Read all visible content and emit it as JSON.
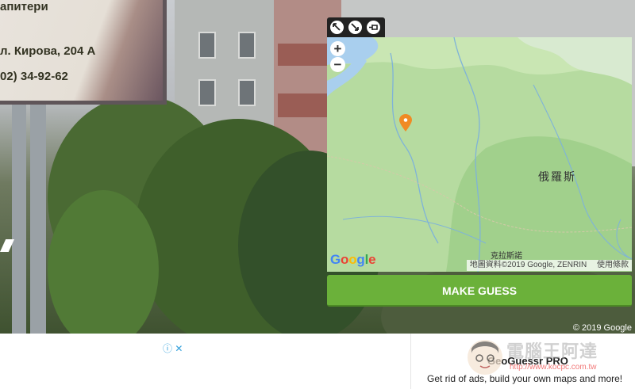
{
  "streetview": {
    "billboard_lines": [
      "апитери",
      "л. Кирова, 204 А",
      "02) 34-92-62"
    ],
    "attribution": "© 2019 Google"
  },
  "map": {
    "tools": [
      "expand-icon",
      "shrink-icon",
      "pin-icon"
    ],
    "zoom_in": "+",
    "zoom_out": "−",
    "labels": {
      "country": "俄羅斯",
      "region": "克拉斯諾"
    },
    "logo": "Google",
    "attribution": "地圖資料©2019 Google, ZENRIN",
    "terms": "使用條款",
    "marker_color": "#f08a24"
  },
  "guess_button": "MAKE GUESS",
  "ad": {
    "info_icons": "ⓘ ✕",
    "pro_title": "GeoGuessr PRO",
    "pro_desc": "Get rid of ads, build your own maps and more!"
  },
  "watermark": {
    "brand": "電腦王阿達",
    "url": "http://www.kocpc.com.tw"
  },
  "colors": {
    "accent": "#6bb13a",
    "map_land": "#b6dba0",
    "water": "#a9cfee"
  }
}
